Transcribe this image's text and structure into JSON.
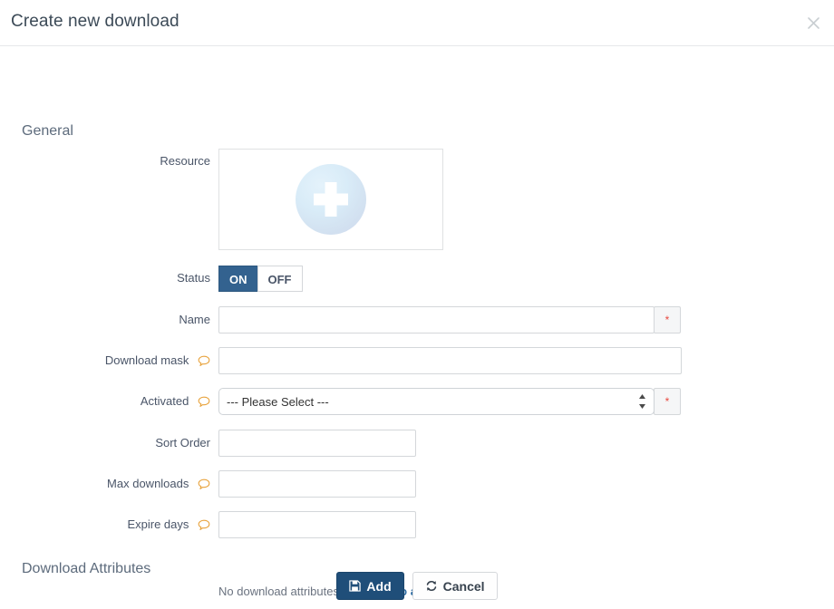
{
  "header": {
    "title": "Create new download",
    "close_icon": "close-icon"
  },
  "sections": {
    "general": "General",
    "attributes": "Download Attributes"
  },
  "form": {
    "resource": {
      "label": "Resource",
      "icon": "plus-upload-icon"
    },
    "status": {
      "label": "Status",
      "on_label": "ON",
      "off_label": "OFF",
      "selected": "ON"
    },
    "name": {
      "label": "Name",
      "value": "",
      "placeholder": "",
      "required_marker": "*"
    },
    "download_mask": {
      "label": "Download mask",
      "value": "",
      "placeholder": "",
      "help_icon": "comment-help-icon"
    },
    "activated": {
      "label": "Activated",
      "selected": "--- Please Select ---",
      "options": [
        "--- Please Select ---"
      ],
      "required_marker": "*",
      "help_icon": "comment-help-icon"
    },
    "sort_order": {
      "label": "Sort Order",
      "value": "",
      "placeholder": ""
    },
    "max_downloads": {
      "label": "Max downloads",
      "value": "",
      "placeholder": "",
      "help_icon": "comment-help-icon"
    },
    "expire_days": {
      "label": "Expire days",
      "value": "",
      "placeholder": "",
      "help_icon": "comment-help-icon"
    }
  },
  "attributes": {
    "empty_text": "No download attributes yet.",
    "add_link": "Click to add"
  },
  "footer": {
    "add_label": "Add",
    "add_icon": "save-floppy-icon",
    "cancel_label": "Cancel",
    "cancel_icon": "refresh-icon"
  },
  "colors": {
    "primary": "#1f4e79",
    "toggle_on": "#33628f",
    "required": "#e8493f",
    "link": "#2d6ca2",
    "help_icon": "#e8a33d"
  }
}
